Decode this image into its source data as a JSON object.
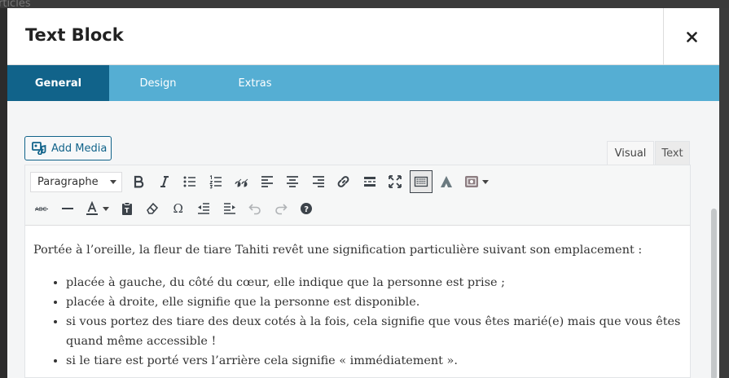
{
  "backdrop": {
    "hint_text": "rticles"
  },
  "modal": {
    "title": "Text Block",
    "close_label": "×"
  },
  "tabs": [
    {
      "label": "General",
      "active": true
    },
    {
      "label": "Design",
      "active": false
    },
    {
      "label": "Extras",
      "active": false
    }
  ],
  "media": {
    "add_label": "Add Media"
  },
  "editor_modes": {
    "visual": "Visual",
    "text": "Text",
    "active": "Visual"
  },
  "toolbar": {
    "format_select": "Paragraphe",
    "row1_icons": [
      "bold-icon",
      "italic-icon",
      "bullet-list-icon",
      "numbered-list-icon",
      "blockquote-icon",
      "align-left-icon",
      "align-center-icon",
      "align-right-icon",
      "link-icon",
      "read-more-icon",
      "fullscreen-icon",
      "toolbar-toggle-icon",
      "avada-icon",
      "shortcode-icon"
    ],
    "row2_icons": [
      "strikethrough-icon",
      "horizontal-line-icon",
      "text-color-icon",
      "paste-text-icon",
      "clear-format-icon",
      "special-char-icon",
      "outdent-icon",
      "indent-icon",
      "undo-icon",
      "redo-icon",
      "help-icon"
    ]
  },
  "content": {
    "intro": "Portée à l’oreille, la fleur de tiare Tahiti revêt une signification particulière suivant son emplacement :",
    "items": [
      "placée à gauche, du côté du cœur, elle indique que la personne est prise ;",
      "placée à droite, elle signifie que la personne est disponible.",
      "si vous portez des tiare des deux cotés à la fois, cela signifie que vous êtes marié(e) mais que vous êtes quand même accessible !",
      "si le tiare est porté vers l’arrière cela signifie « immédiatement »."
    ]
  },
  "colors": {
    "tab_bar": "#55aed3",
    "tab_active": "#11638a",
    "accent": "#11638a"
  }
}
